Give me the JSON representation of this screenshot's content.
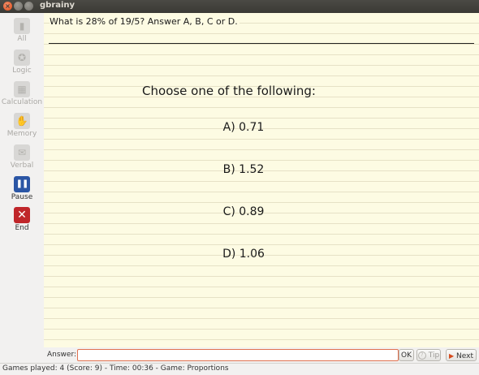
{
  "window": {
    "title": "gbrainy"
  },
  "sidebar": {
    "items": [
      {
        "label": "All",
        "icon": "all-games-icon"
      },
      {
        "label": "Logic",
        "icon": "logic-icon"
      },
      {
        "label": "Calculation",
        "icon": "calculation-icon"
      },
      {
        "label": "Memory",
        "icon": "memory-icon"
      },
      {
        "label": "Verbal",
        "icon": "verbal-icon"
      },
      {
        "label": "Pause",
        "icon": "pause-icon"
      },
      {
        "label": "End",
        "icon": "end-icon"
      }
    ]
  },
  "game": {
    "question": "What is 28% of 19/5? Answer A, B, C or D.",
    "prompt": "Choose one of the following:",
    "options": [
      "A) 0.71",
      "B) 1.52",
      "C) 0.89",
      "D) 1.06"
    ]
  },
  "answer_bar": {
    "label": "Answer:",
    "value": "",
    "ok_label": "OK",
    "tip_label": "Tip",
    "next_label": "Next"
  },
  "status": {
    "text": "Games played: 4 (Score: 9) - Time: 00:36 - Game: Proportions"
  }
}
